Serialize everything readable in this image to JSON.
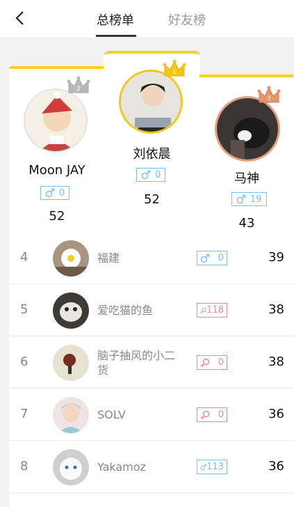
{
  "header": {
    "tabs": [
      {
        "label": "总榜单",
        "active": true
      },
      {
        "label": "好友榜",
        "active": false
      }
    ]
  },
  "podium": {
    "first": {
      "rank": "1",
      "name": "刘依晨",
      "gender": "male",
      "gender_value": "0",
      "score": "52",
      "crown_color": "#f5c518"
    },
    "second": {
      "rank": "2",
      "name": "Moon JAY",
      "gender": "male",
      "gender_value": "0",
      "score": "52",
      "crown_color": "#b8b8b8"
    },
    "third": {
      "rank": "3",
      "name": "马神",
      "gender": "male",
      "gender_value": "19",
      "score": "43",
      "crown_color": "#e8936a"
    }
  },
  "list": [
    {
      "rank": "4",
      "name": "福建",
      "gender": "male",
      "gender_value": "0",
      "score": "39"
    },
    {
      "rank": "5",
      "name": "爱吃猫的鱼",
      "gender": "female",
      "gender_value": "118",
      "score": "38"
    },
    {
      "rank": "6",
      "name": "脑子抽风的小二货",
      "gender": "female",
      "gender_value": "0",
      "score": "38"
    },
    {
      "rank": "7",
      "name": "SOLV",
      "gender": "female",
      "gender_value": "0",
      "score": "36"
    },
    {
      "rank": "8",
      "name": "Yakamoz",
      "gender": "male",
      "gender_value": "113",
      "score": "36"
    }
  ],
  "colors": {
    "accent": "#f7d21e",
    "male": "#7fbfe3",
    "female": "#e88a98"
  }
}
